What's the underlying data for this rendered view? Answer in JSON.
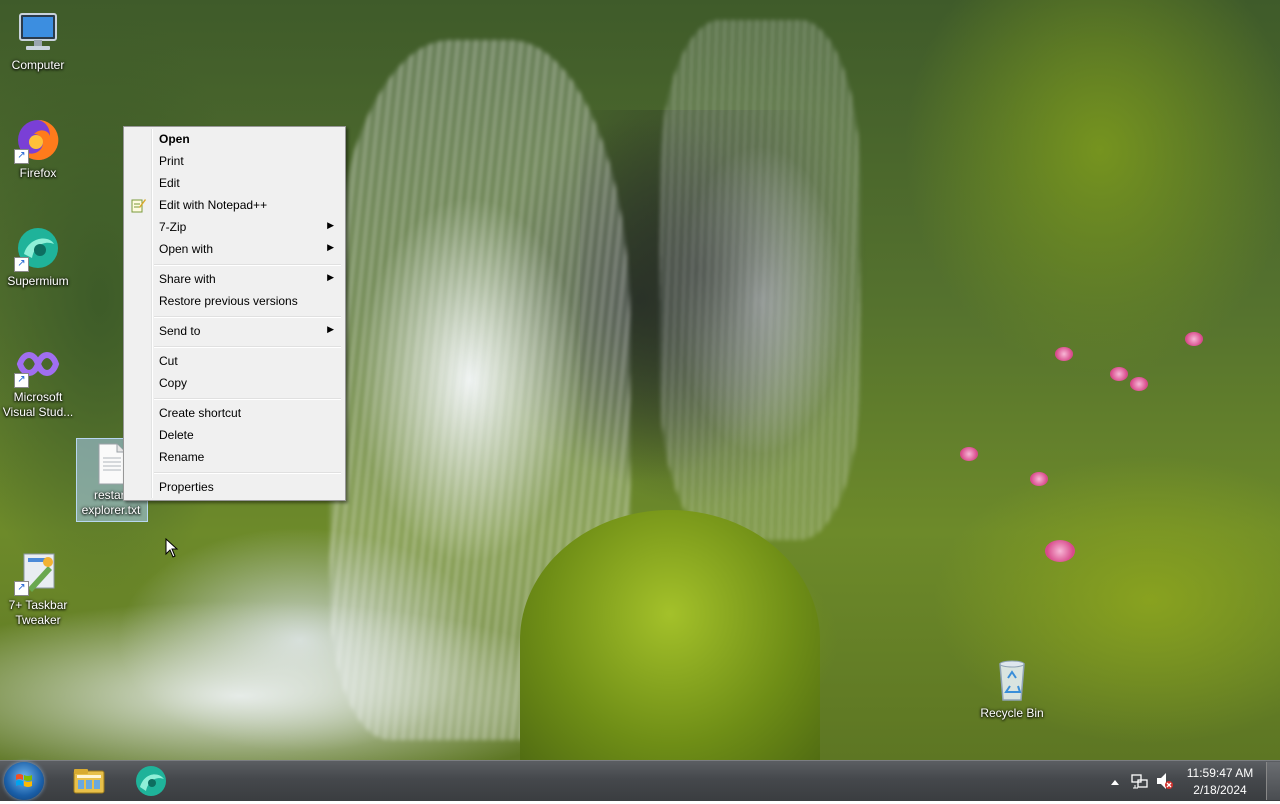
{
  "desktop_icons": [
    {
      "label": "Computer",
      "icon": "computer-icon"
    },
    {
      "label": "Firefox",
      "icon": "firefox-icon"
    },
    {
      "label": "Supermium",
      "icon": "supermium-icon"
    },
    {
      "label": "Microsoft Visual Stud...",
      "icon": "visual-studio-icon"
    },
    {
      "label": "restart explorer.txt",
      "icon": "text-file-icon"
    },
    {
      "label": "7+ Taskbar Tweaker",
      "icon": "taskbar-tweaker-icon"
    },
    {
      "label": "Recycle Bin",
      "icon": "recycle-bin-icon"
    }
  ],
  "context_menu": {
    "items": [
      {
        "label": "Open",
        "bold": true
      },
      {
        "label": "Print"
      },
      {
        "label": "Edit"
      },
      {
        "label": "Edit with Notepad++",
        "icon": "notepadpp-icon"
      },
      {
        "label": "7-Zip",
        "submenu": true
      },
      {
        "label": "Open with",
        "submenu": true
      },
      {
        "label": "Share with",
        "submenu": true
      },
      {
        "label": "Restore previous versions"
      },
      {
        "label": "Send to",
        "submenu": true
      },
      {
        "label": "Cut"
      },
      {
        "label": "Copy"
      },
      {
        "label": "Create shortcut"
      },
      {
        "label": "Delete"
      },
      {
        "label": "Rename"
      },
      {
        "label": "Properties"
      }
    ],
    "submenu_arrow": "▶"
  },
  "taskbar": {
    "pinned": [
      "windows-explorer-icon",
      "supermium-icon"
    ],
    "tray_icons": [
      "show-hidden-icons",
      "network-icon",
      "volume-muted-icon"
    ],
    "clock": {
      "time": "11:59:47 AM",
      "date": "2/18/2024"
    }
  }
}
